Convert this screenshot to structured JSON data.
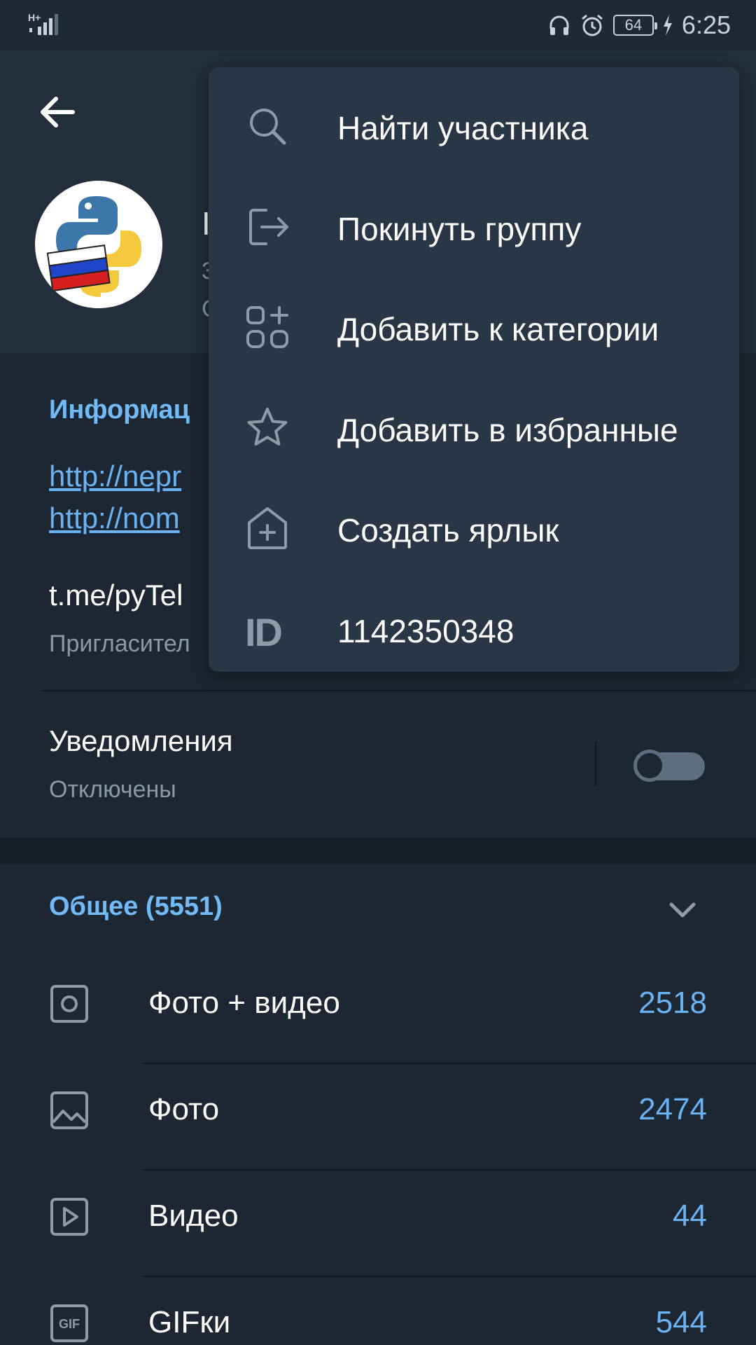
{
  "status_bar": {
    "time": "6:25",
    "battery": "64",
    "network": "H+"
  },
  "header": {
    "back_icon": "arrow-left-icon",
    "title_partial": "I",
    "subtitle_partial_1": "3",
    "subtitle_partial_2": "C"
  },
  "info": {
    "title": "Информац",
    "link_1": "http://nepr",
    "link_2": "http://nom",
    "invite_link": "t.me/pyTel",
    "invite_label": "Пригласител",
    "notifications_title": "Уведомления",
    "notifications_status": "Отключены"
  },
  "media": {
    "title": "Общее (5551)",
    "rows": [
      {
        "label": "Фото + видео",
        "count": "2518",
        "icon": "photo-video-icon"
      },
      {
        "label": "Фото",
        "count": "2474",
        "icon": "image-icon"
      },
      {
        "label": "Видео",
        "count": "44",
        "icon": "play-icon"
      },
      {
        "label": "GIFки",
        "count": "544",
        "icon": "gif-icon"
      }
    ]
  },
  "menu": {
    "items": [
      {
        "label": "Найти участника",
        "icon": "search-icon"
      },
      {
        "label": "Покинуть группу",
        "icon": "leave-icon"
      },
      {
        "label": "Добавить к категории",
        "icon": "category-add-icon"
      },
      {
        "label": "Добавить в избранные",
        "icon": "star-icon"
      },
      {
        "label": "Создать ярлык",
        "icon": "shortcut-icon"
      },
      {
        "label": "1142350348",
        "icon": "id-icon",
        "glyph": "ID"
      }
    ]
  },
  "colors": {
    "background": "#1d2733",
    "header": "#222e3b",
    "menu": "#283645",
    "accent": "#6ab2f2",
    "secondary_text": "#8b98a5"
  }
}
